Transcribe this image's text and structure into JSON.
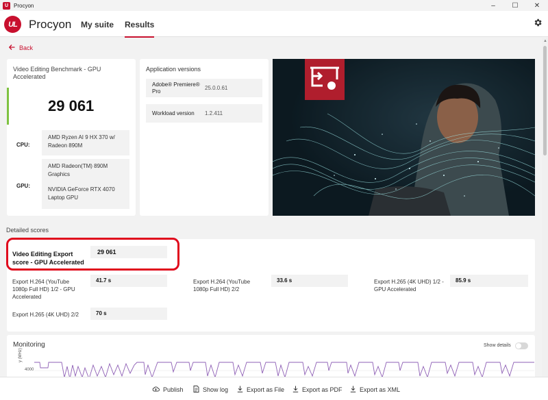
{
  "window": {
    "title": "Procyon",
    "controls": [
      "–",
      "☐",
      "✕"
    ]
  },
  "nav": {
    "brand": "Procyon",
    "logo_text": "UL",
    "tabs": [
      {
        "label": "My suite",
        "active": false
      },
      {
        "label": "Results",
        "active": true
      }
    ],
    "settings_icon": "gear-icon"
  },
  "back": {
    "label": "Back"
  },
  "benchmark": {
    "title": "Video Editing Benchmark - GPU Accelerated",
    "score": "29 061",
    "status_color": "#7fc241",
    "cpu_label": "CPU:",
    "cpu_value": "AMD Ryzen AI 9 HX 370 w/ Radeon 890M",
    "gpu_label": "GPU:",
    "gpu_values": [
      "AMD Radeon(TM) 890M Graphics",
      "NVIDIA GeForce RTX 4070 Laptop GPU"
    ]
  },
  "apps": {
    "title": "Application versions",
    "rows": [
      {
        "name": "Adobe® Premiere® Pro",
        "version": "25.0.0.61"
      },
      {
        "name": "Workload version",
        "version": "1.2.411"
      }
    ]
  },
  "hero": {
    "badge_icon": "presentation-icon",
    "badge_color": "#b01e2d"
  },
  "detailed": {
    "label": "Detailed scores",
    "main": {
      "label": "Video Editing Export score - GPU Accelerated",
      "value": "29 061"
    },
    "items": [
      {
        "label": "Export H.264 (YouTube 1080p Full HD) 1/2 - GPU Accelerated",
        "value": "41.7 s"
      },
      {
        "label": "Export H.264 (YouTube 1080p Full HD) 2/2",
        "value": "33.6 s"
      },
      {
        "label": "Export H.265 (4K UHD) 1/2 - GPU Accelerated",
        "value": "85.9 s"
      },
      {
        "label": "Export H.265 (4K UHD) 2/2",
        "value": "70 s"
      }
    ]
  },
  "monitoring": {
    "title": "Monitoring",
    "show_details_label": "Show details",
    "show_details_on": false,
    "axis_label": "y (MHz)",
    "tick_label": "4000",
    "line_color": "#8e5fb5"
  },
  "toolbar": {
    "items": [
      {
        "label": "Publish",
        "icon": "cloud-upload-icon"
      },
      {
        "label": "Show log",
        "icon": "document-icon"
      },
      {
        "label": "Export as File",
        "icon": "download-icon"
      },
      {
        "label": "Export as PDF",
        "icon": "download-icon"
      },
      {
        "label": "Export as XML",
        "icon": "download-icon"
      }
    ]
  }
}
